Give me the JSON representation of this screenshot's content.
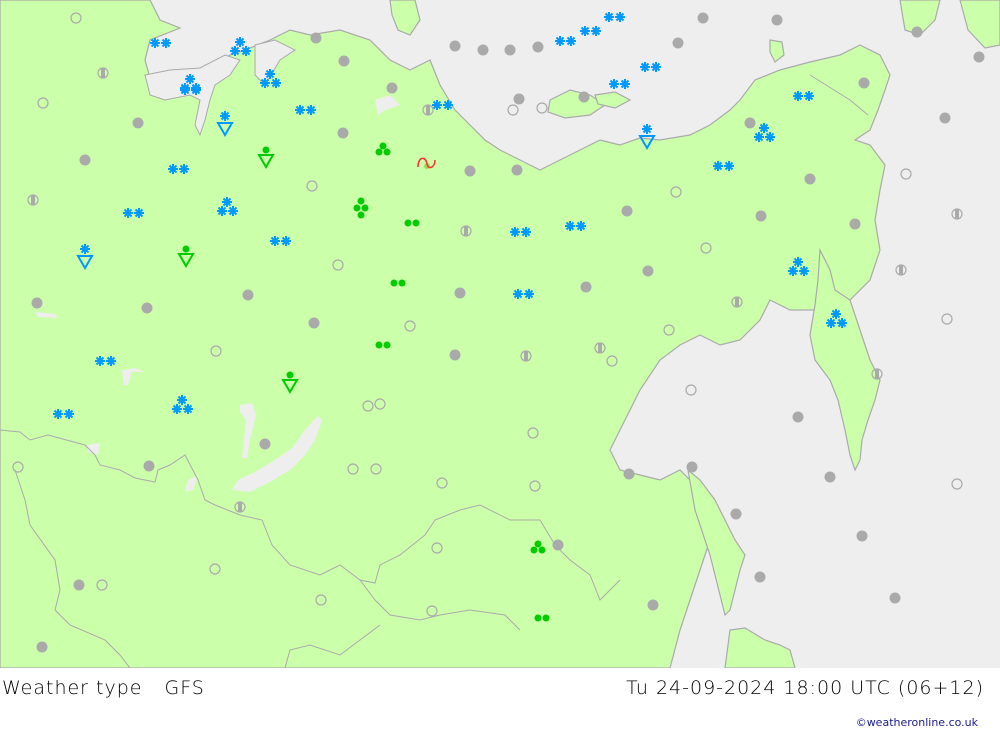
{
  "title": "Weather type",
  "model": "GFS",
  "valid_time": "Tu 24-09-2024 18:00 UTC (06+12)",
  "credit": "©weatheronline.co.uk",
  "colors": {
    "land": "#ccffaa",
    "sea": "#eeeeee",
    "border": "#aaaaaa",
    "snow": "#0099ff",
    "rain": "#00cc00",
    "cloud": "#aaaaaa",
    "thunder": "#ff3333"
  },
  "symbol_types": {
    "overcast": "filled grey circle",
    "partly_cloudy": "half-filled grey circle",
    "clear": "empty grey circle",
    "snow_light": "two snowflakes",
    "snow_moderate": "three snowflakes",
    "snow_shower": "snowflake over triangle",
    "rain_light": "two green dots",
    "rain_moderate": "three green dots",
    "rain_heavy": "four green dots",
    "rain_shower": "green dot over triangle",
    "thunderstorm": "red wave"
  }
}
